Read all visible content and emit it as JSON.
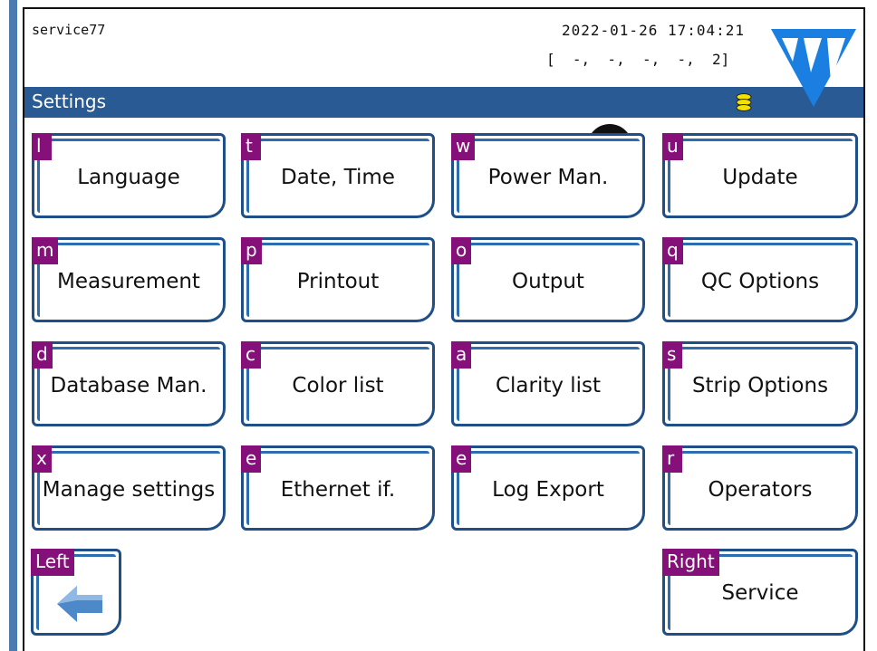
{
  "header": {
    "user": "service77",
    "datetime": "2022-01-26 17:04:21",
    "counters": "[  -,  -,  -,  -,  2]"
  },
  "titlebar": {
    "title": "Settings"
  },
  "badge": "❸",
  "buttons": [
    {
      "key": "l",
      "label": "Language"
    },
    {
      "key": "t",
      "label": "Date, Time"
    },
    {
      "key": "w",
      "label": "Power Man."
    },
    {
      "key": "u",
      "label": "Update"
    },
    {
      "key": "m",
      "label": "Measurement"
    },
    {
      "key": "p",
      "label": "Printout"
    },
    {
      "key": "o",
      "label": "Output"
    },
    {
      "key": "q",
      "label": "QC Options"
    },
    {
      "key": "d",
      "label": "Database Man."
    },
    {
      "key": "c",
      "label": "Color list"
    },
    {
      "key": "a",
      "label": "Clarity list"
    },
    {
      "key": "s",
      "label": "Strip Options"
    },
    {
      "key": "x",
      "label": "Manage settings"
    },
    {
      "key": "e",
      "label": "Ethernet if."
    },
    {
      "key": "e",
      "label": "Log Export"
    },
    {
      "key": "r",
      "label": "Operators"
    }
  ],
  "nav": {
    "left": {
      "key": "Left"
    },
    "right": {
      "key": "Right",
      "label": "Service"
    }
  },
  "colors": {
    "accent_blue": "#2a5a93",
    "key_purple": "#86107a",
    "logo_blue": "#1a7fe0"
  }
}
